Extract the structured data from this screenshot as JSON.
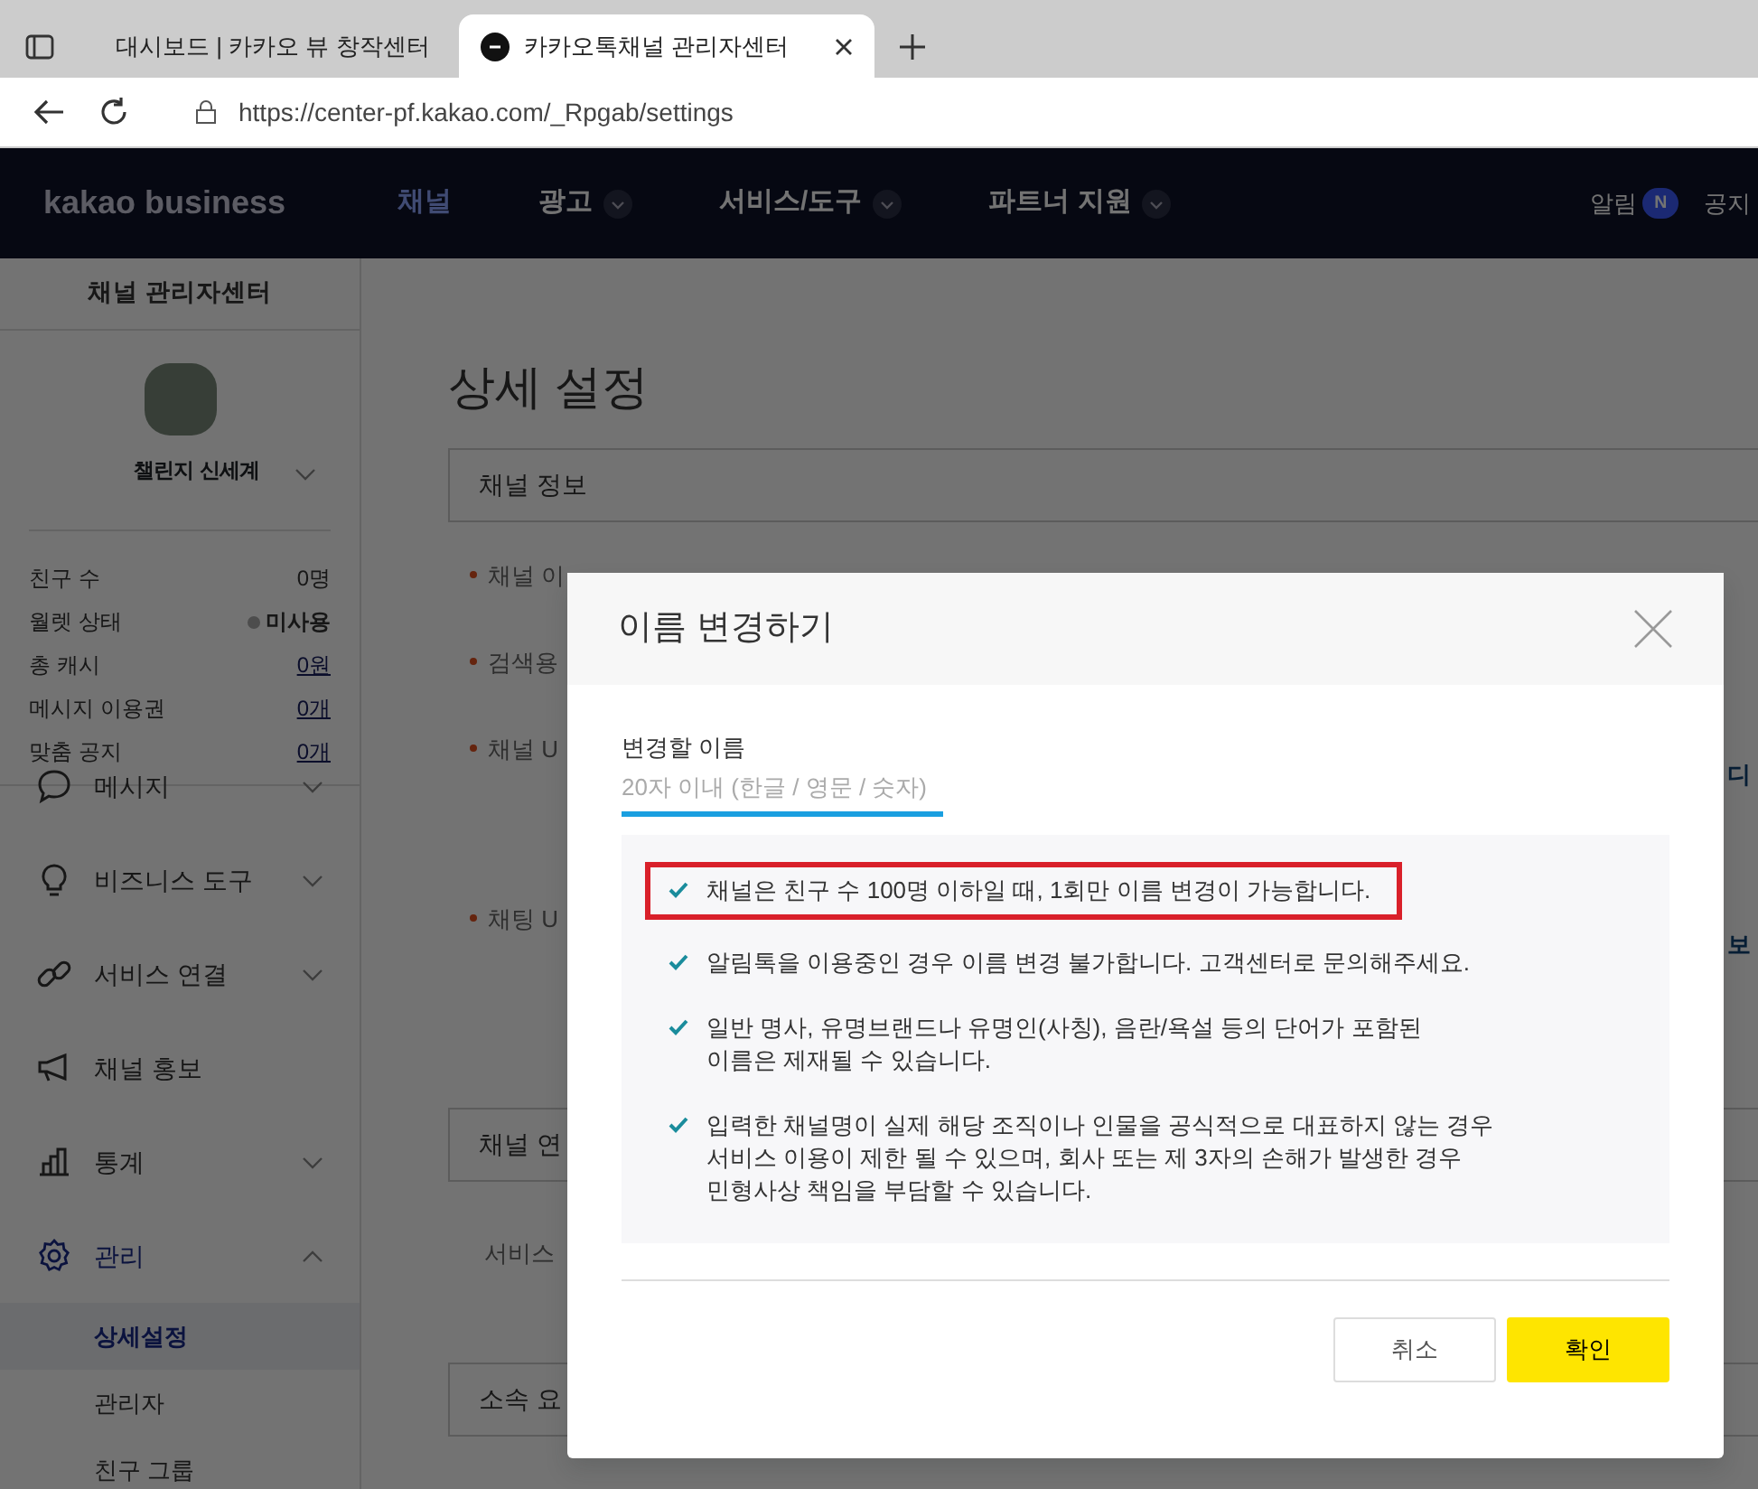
{
  "browser": {
    "tabs": [
      {
        "title": "대시보드 | 카카오 뷰 창작센터",
        "selected": false
      },
      {
        "title": "카카오톡채널 관리자센터",
        "selected": true
      }
    ],
    "url": "https://center-pf.kakao.com/_Rpgab/settings"
  },
  "navbar": {
    "logo": "kakao business",
    "menu": [
      {
        "label": "채널",
        "selected": true,
        "dropdown": false
      },
      {
        "label": "광고",
        "selected": false,
        "dropdown": true
      },
      {
        "label": "서비스/도구",
        "selected": false,
        "dropdown": true
      },
      {
        "label": "파트너 지원",
        "selected": false,
        "dropdown": true
      }
    ],
    "alert": {
      "label": "알림",
      "badge": "N"
    },
    "notice": "공지"
  },
  "sidebar": {
    "title": "채널 관리자센터",
    "channel_name": "챌린지 신세계",
    "stats": [
      {
        "label": "친구 수",
        "value": "0명",
        "kind": "plain"
      },
      {
        "label": "월렛 상태",
        "value": "미사용",
        "kind": "status"
      },
      {
        "label": "총 캐시",
        "value": "0원",
        "kind": "link"
      },
      {
        "label": "메시지 이용권",
        "value": "0개",
        "kind": "link"
      },
      {
        "label": "맞춤 공지",
        "value": "0개",
        "kind": "link"
      }
    ],
    "menu": [
      {
        "label": "메시지",
        "expanded": false,
        "has_toggle": true
      },
      {
        "label": "비즈니스 도구",
        "expanded": false,
        "has_toggle": true
      },
      {
        "label": "서비스 연결",
        "expanded": false,
        "has_toggle": true
      },
      {
        "label": "채널 홍보",
        "expanded": false,
        "has_toggle": false
      },
      {
        "label": "통계",
        "expanded": false,
        "has_toggle": true
      },
      {
        "label": "관리",
        "expanded": true,
        "has_toggle": true,
        "children": [
          {
            "label": "상세설정",
            "selected": true
          },
          {
            "label": "관리자",
            "selected": false
          },
          {
            "label": "친구 그룹",
            "selected": false
          }
        ]
      }
    ]
  },
  "main": {
    "title": "상세 설정",
    "blocks": [
      {
        "kind": "section",
        "label": "채널 정보"
      },
      {
        "kind": "field",
        "label": "채널 이"
      },
      {
        "kind": "field",
        "label": "검색용"
      },
      {
        "kind": "field",
        "label": "채널 U",
        "side_text": "디"
      },
      {
        "kind": "field",
        "label": "채팅 U",
        "side_text": "보"
      },
      {
        "kind": "section",
        "label": "채널 연"
      },
      {
        "kind": "text",
        "label": "서비스"
      },
      {
        "kind": "section",
        "label": "소속 요"
      }
    ]
  },
  "modal": {
    "title": "이름 변경하기",
    "field_label": "변경할 이름",
    "placeholder": "20자 이내 (한글 / 영문 / 숫자)",
    "notices": [
      {
        "text": "채널은 친구 수 100명 이하일 때, 1회만 이름 변경이 가능합니다.",
        "highlighted": true
      },
      {
        "text": "알림톡을 이용중인 경우 이름 변경 불가합니다. 고객센터로 문의해주세요.",
        "highlighted": false
      },
      {
        "text": "일반 명사, 유명브랜드나 유명인(사칭), 음란/욕설 등의 단어가 포함된 이름은 제재될 수 있습니다.",
        "highlighted": false
      },
      {
        "text": "입력한 채널명이 실제 해당 조직이나 인물을 공식적으로 대표하지 않는 경우 서비스 이용이 제한 될 수 있으며, 회사 또는 제 3자의 손해가 발생한 경우 민형사상 책임을 부담할 수 있습니다.",
        "highlighted": false
      }
    ],
    "buttons": [
      {
        "label": "취소",
        "kind": "secondary"
      },
      {
        "label": "확인",
        "kind": "primary"
      }
    ]
  }
}
